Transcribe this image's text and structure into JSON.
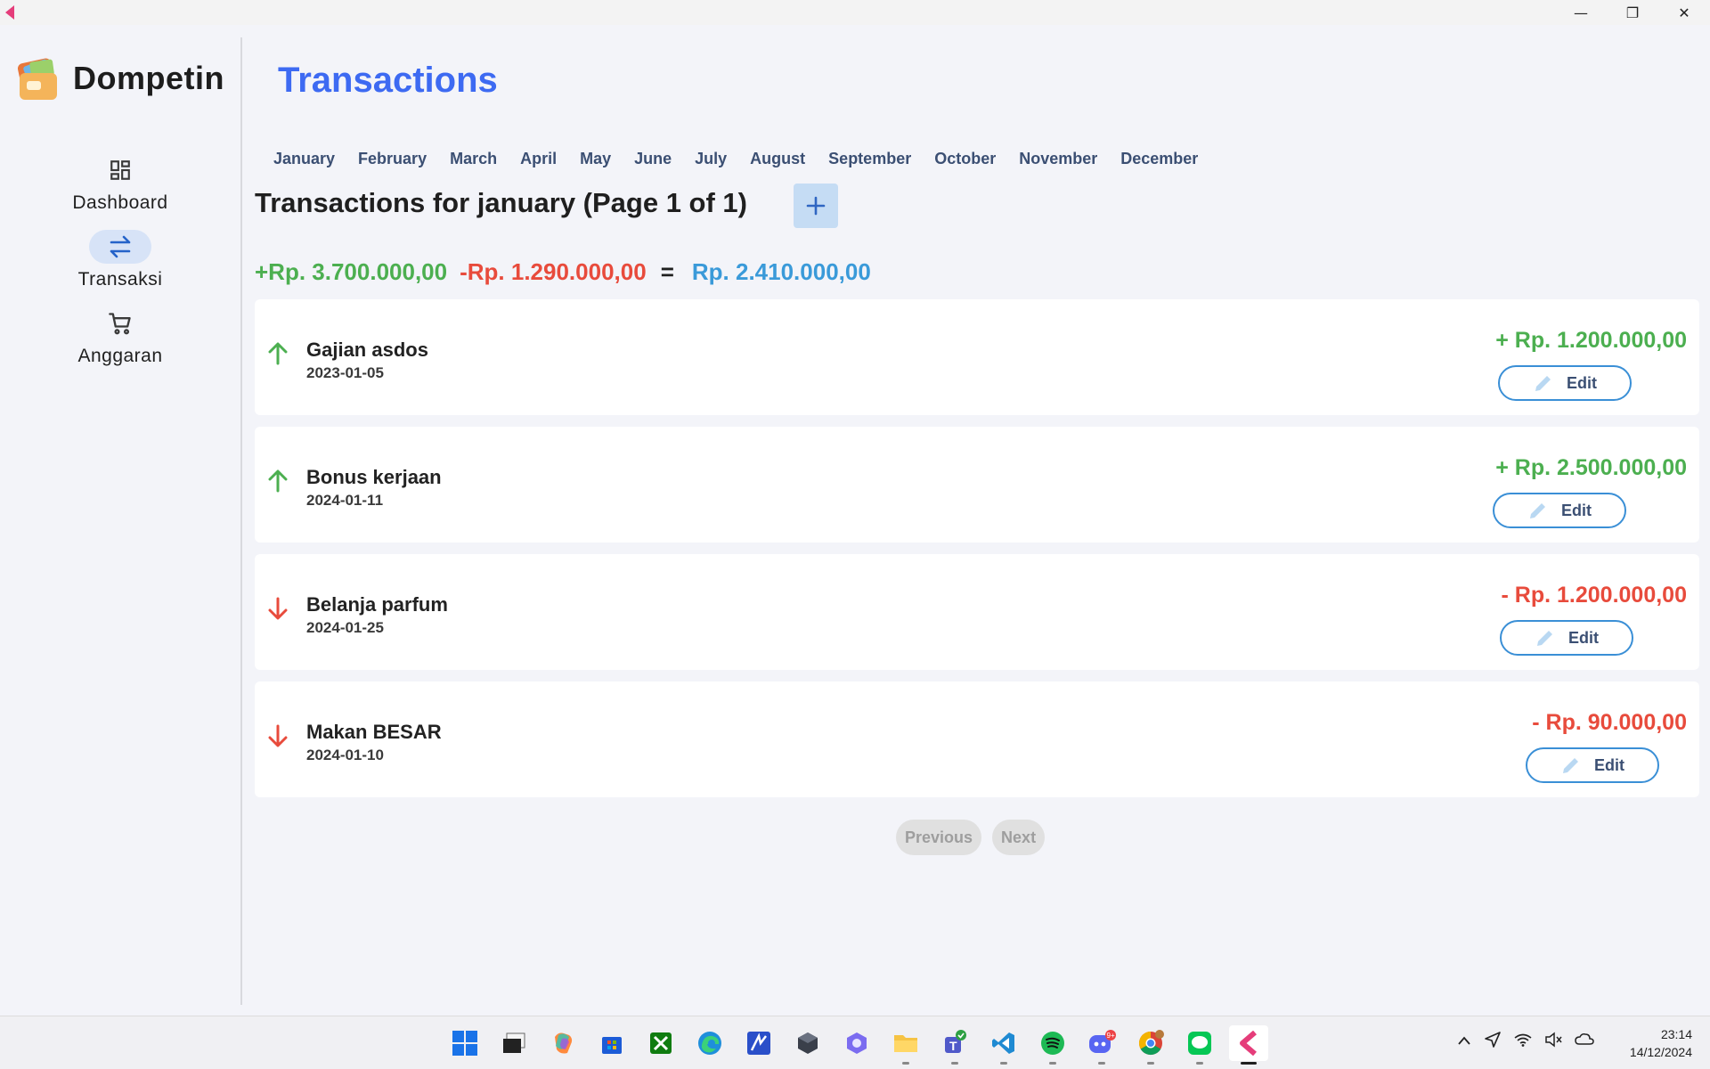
{
  "window": {
    "minimize": "—",
    "restore": "❐",
    "close": "✕"
  },
  "sidebar": {
    "brand": "Dompetin",
    "items": [
      {
        "label": "Dashboard",
        "icon": "dashboard-icon",
        "active": false
      },
      {
        "label": "Transaksi",
        "icon": "swap-arrows-icon",
        "active": true
      },
      {
        "label": "Anggaran",
        "icon": "cart-icon",
        "active": false
      }
    ]
  },
  "main": {
    "title": "Transactions",
    "months": [
      "January",
      "February",
      "March",
      "April",
      "May",
      "June",
      "July",
      "August",
      "September",
      "October",
      "November",
      "December"
    ],
    "section_title": "Transactions for january (Page 1 of 1)",
    "add_label": "+",
    "summary": {
      "income": "+Rp. 3.700.000,00",
      "expense": "-Rp. 1.290.000,00",
      "equals": "=",
      "total": "Rp. 2.410.000,00"
    },
    "transactions": [
      {
        "name": "Gajian asdos",
        "date": "2023-01-05",
        "amount": "+ Rp. 1.200.000,00",
        "type": "income",
        "edit": "Edit"
      },
      {
        "name": "Bonus kerjaan",
        "date": "2024-01-11",
        "amount": "+ Rp. 2.500.000,00",
        "type": "income",
        "edit": "Edit"
      },
      {
        "name": "Belanja parfum",
        "date": "2024-01-25",
        "amount": "- Rp. 1.200.000,00",
        "type": "expense",
        "edit": "Edit"
      },
      {
        "name": "Makan BESAR",
        "date": "2024-01-10",
        "amount": "- Rp. 90.000,00",
        "type": "expense",
        "edit": "Edit"
      }
    ],
    "pager": {
      "previous": "Previous",
      "next": "Next"
    }
  },
  "colors": {
    "accent": "#3d6af2",
    "income": "#4caf50",
    "expense": "#e84b3c",
    "total": "#3a9ad9",
    "edit_border": "#3a8fd6"
  },
  "taskbar": {
    "time": "23:14",
    "date": "14/12/2024",
    "apps": [
      "windows-start-icon",
      "file-stack-icon",
      "copilot-icon",
      "store-icon",
      "xbox-icon",
      "edge-icon",
      "pen-app-icon",
      "cube-app-icon",
      "hex-app-icon",
      "file-explorer-icon",
      "teams-icon",
      "vscode-icon",
      "spotify-icon",
      "discord-icon",
      "chrome-icon",
      "line-icon",
      "dompetin-app-icon"
    ]
  }
}
